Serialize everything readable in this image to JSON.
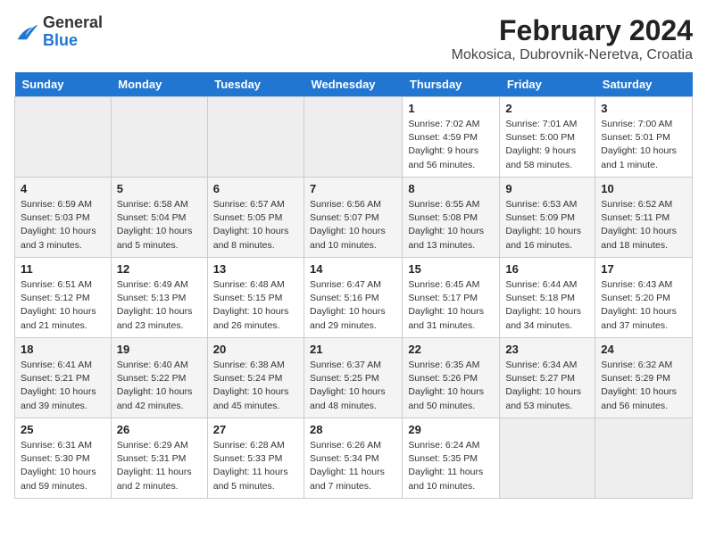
{
  "logo": {
    "general": "General",
    "blue": "Blue"
  },
  "title": "February 2024",
  "subtitle": "Mokosica, Dubrovnik-Neretva, Croatia",
  "days_of_week": [
    "Sunday",
    "Monday",
    "Tuesday",
    "Wednesday",
    "Thursday",
    "Friday",
    "Saturday"
  ],
  "weeks": [
    [
      {
        "day": "",
        "info": ""
      },
      {
        "day": "",
        "info": ""
      },
      {
        "day": "",
        "info": ""
      },
      {
        "day": "",
        "info": ""
      },
      {
        "day": "1",
        "info": "Sunrise: 7:02 AM\nSunset: 4:59 PM\nDaylight: 9 hours\nand 56 minutes."
      },
      {
        "day": "2",
        "info": "Sunrise: 7:01 AM\nSunset: 5:00 PM\nDaylight: 9 hours\nand 58 minutes."
      },
      {
        "day": "3",
        "info": "Sunrise: 7:00 AM\nSunset: 5:01 PM\nDaylight: 10 hours\nand 1 minute."
      }
    ],
    [
      {
        "day": "4",
        "info": "Sunrise: 6:59 AM\nSunset: 5:03 PM\nDaylight: 10 hours\nand 3 minutes."
      },
      {
        "day": "5",
        "info": "Sunrise: 6:58 AM\nSunset: 5:04 PM\nDaylight: 10 hours\nand 5 minutes."
      },
      {
        "day": "6",
        "info": "Sunrise: 6:57 AM\nSunset: 5:05 PM\nDaylight: 10 hours\nand 8 minutes."
      },
      {
        "day": "7",
        "info": "Sunrise: 6:56 AM\nSunset: 5:07 PM\nDaylight: 10 hours\nand 10 minutes."
      },
      {
        "day": "8",
        "info": "Sunrise: 6:55 AM\nSunset: 5:08 PM\nDaylight: 10 hours\nand 13 minutes."
      },
      {
        "day": "9",
        "info": "Sunrise: 6:53 AM\nSunset: 5:09 PM\nDaylight: 10 hours\nand 16 minutes."
      },
      {
        "day": "10",
        "info": "Sunrise: 6:52 AM\nSunset: 5:11 PM\nDaylight: 10 hours\nand 18 minutes."
      }
    ],
    [
      {
        "day": "11",
        "info": "Sunrise: 6:51 AM\nSunset: 5:12 PM\nDaylight: 10 hours\nand 21 minutes."
      },
      {
        "day": "12",
        "info": "Sunrise: 6:49 AM\nSunset: 5:13 PM\nDaylight: 10 hours\nand 23 minutes."
      },
      {
        "day": "13",
        "info": "Sunrise: 6:48 AM\nSunset: 5:15 PM\nDaylight: 10 hours\nand 26 minutes."
      },
      {
        "day": "14",
        "info": "Sunrise: 6:47 AM\nSunset: 5:16 PM\nDaylight: 10 hours\nand 29 minutes."
      },
      {
        "day": "15",
        "info": "Sunrise: 6:45 AM\nSunset: 5:17 PM\nDaylight: 10 hours\nand 31 minutes."
      },
      {
        "day": "16",
        "info": "Sunrise: 6:44 AM\nSunset: 5:18 PM\nDaylight: 10 hours\nand 34 minutes."
      },
      {
        "day": "17",
        "info": "Sunrise: 6:43 AM\nSunset: 5:20 PM\nDaylight: 10 hours\nand 37 minutes."
      }
    ],
    [
      {
        "day": "18",
        "info": "Sunrise: 6:41 AM\nSunset: 5:21 PM\nDaylight: 10 hours\nand 39 minutes."
      },
      {
        "day": "19",
        "info": "Sunrise: 6:40 AM\nSunset: 5:22 PM\nDaylight: 10 hours\nand 42 minutes."
      },
      {
        "day": "20",
        "info": "Sunrise: 6:38 AM\nSunset: 5:24 PM\nDaylight: 10 hours\nand 45 minutes."
      },
      {
        "day": "21",
        "info": "Sunrise: 6:37 AM\nSunset: 5:25 PM\nDaylight: 10 hours\nand 48 minutes."
      },
      {
        "day": "22",
        "info": "Sunrise: 6:35 AM\nSunset: 5:26 PM\nDaylight: 10 hours\nand 50 minutes."
      },
      {
        "day": "23",
        "info": "Sunrise: 6:34 AM\nSunset: 5:27 PM\nDaylight: 10 hours\nand 53 minutes."
      },
      {
        "day": "24",
        "info": "Sunrise: 6:32 AM\nSunset: 5:29 PM\nDaylight: 10 hours\nand 56 minutes."
      }
    ],
    [
      {
        "day": "25",
        "info": "Sunrise: 6:31 AM\nSunset: 5:30 PM\nDaylight: 10 hours\nand 59 minutes."
      },
      {
        "day": "26",
        "info": "Sunrise: 6:29 AM\nSunset: 5:31 PM\nDaylight: 11 hours\nand 2 minutes."
      },
      {
        "day": "27",
        "info": "Sunrise: 6:28 AM\nSunset: 5:33 PM\nDaylight: 11 hours\nand 5 minutes."
      },
      {
        "day": "28",
        "info": "Sunrise: 6:26 AM\nSunset: 5:34 PM\nDaylight: 11 hours\nand 7 minutes."
      },
      {
        "day": "29",
        "info": "Sunrise: 6:24 AM\nSunset: 5:35 PM\nDaylight: 11 hours\nand 10 minutes."
      },
      {
        "day": "",
        "info": ""
      },
      {
        "day": "",
        "info": ""
      }
    ]
  ]
}
